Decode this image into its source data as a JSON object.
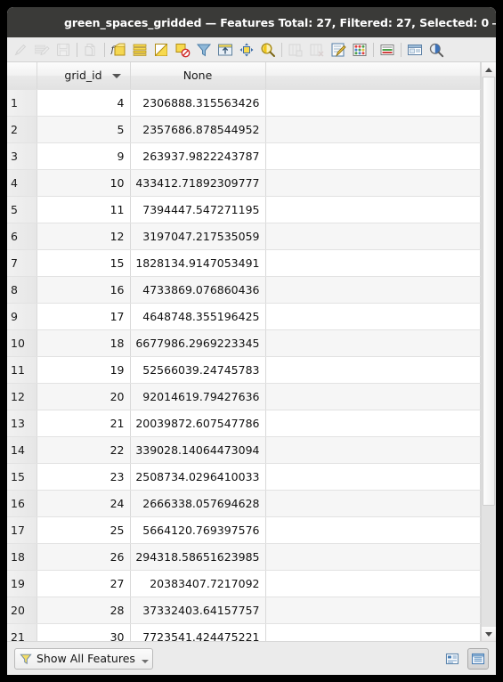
{
  "window": {
    "title": "green_spaces_gridded — Features Total: 27, Filtered: 27, Selected: 0",
    "buttons": {
      "minimize": "—",
      "maximize": "+",
      "close": "×"
    }
  },
  "toolbar": {
    "items": [
      {
        "name": "toggle-editing-icon",
        "label": "Toggle editing mode",
        "disabled": true
      },
      {
        "name": "multi-edit-icon",
        "label": "Toggle multi edit mode",
        "disabled": true
      },
      {
        "name": "save-edits-icon",
        "label": "Save edits",
        "disabled": true
      },
      {
        "name": "separator",
        "label": "",
        "disabled": false
      },
      {
        "name": "reload-table-icon",
        "label": "Reload the table",
        "disabled": true
      },
      {
        "name": "separator",
        "label": "",
        "disabled": false
      },
      {
        "name": "select-by-expression-icon",
        "label": "Select features using an expression",
        "disabled": false
      },
      {
        "name": "select-all-icon",
        "label": "Select all features",
        "disabled": false
      },
      {
        "name": "invert-selection-icon",
        "label": "Invert selection",
        "disabled": false
      },
      {
        "name": "deselect-all-icon",
        "label": "Deselect all features",
        "disabled": false
      },
      {
        "name": "filter-selection-icon",
        "label": "Filter / select features",
        "disabled": false
      },
      {
        "name": "move-selection-to-top-icon",
        "label": "Move selection to top",
        "disabled": false
      },
      {
        "name": "pan-to-selection-icon",
        "label": "Pan map to selected rows",
        "disabled": false
      },
      {
        "name": "zoom-to-selection-icon",
        "label": "Zoom map to selected rows",
        "disabled": false
      },
      {
        "name": "separator",
        "label": "",
        "disabled": false
      },
      {
        "name": "new-field-icon",
        "label": "New field",
        "disabled": true
      },
      {
        "name": "delete-field-icon",
        "label": "Delete field",
        "disabled": true
      },
      {
        "name": "open-field-calculator-icon",
        "label": "Open field calculator",
        "disabled": false
      },
      {
        "name": "conditional-formatting-icon",
        "label": "Conditional formatting",
        "disabled": false
      },
      {
        "name": "separator",
        "label": "",
        "disabled": false
      },
      {
        "name": "organize-columns-icon",
        "label": "Organize columns",
        "disabled": false
      },
      {
        "name": "separator",
        "label": "",
        "disabled": false
      },
      {
        "name": "actions-icon",
        "label": "Actions",
        "disabled": false
      },
      {
        "name": "form-view-search-icon",
        "label": "Expression select",
        "disabled": false
      }
    ]
  },
  "table": {
    "columns": [
      {
        "key": "rownum",
        "label": "",
        "sortable": false
      },
      {
        "key": "grid_id",
        "label": "grid_id",
        "sortable": true
      },
      {
        "key": "none",
        "label": "None",
        "sortable": false
      },
      {
        "key": "blank",
        "label": "",
        "sortable": false
      }
    ],
    "rows": [
      {
        "rownum": "1",
        "grid_id": "4",
        "none": "2306888.315563426"
      },
      {
        "rownum": "2",
        "grid_id": "5",
        "none": "2357686.878544952"
      },
      {
        "rownum": "3",
        "grid_id": "9",
        "none": "263937.9822243787"
      },
      {
        "rownum": "4",
        "grid_id": "10",
        "none": "433412.71892309777"
      },
      {
        "rownum": "5",
        "grid_id": "11",
        "none": "7394447.547271195"
      },
      {
        "rownum": "6",
        "grid_id": "12",
        "none": "3197047.217535059"
      },
      {
        "rownum": "7",
        "grid_id": "15",
        "none": "1828134.9147053491"
      },
      {
        "rownum": "8",
        "grid_id": "16",
        "none": "4733869.076860436"
      },
      {
        "rownum": "9",
        "grid_id": "17",
        "none": "4648748.355196425"
      },
      {
        "rownum": "10",
        "grid_id": "18",
        "none": "6677986.2969223345"
      },
      {
        "rownum": "11",
        "grid_id": "19",
        "none": "52566039.24745783"
      },
      {
        "rownum": "12",
        "grid_id": "20",
        "none": "92014619.79427636"
      },
      {
        "rownum": "13",
        "grid_id": "21",
        "none": "20039872.607547786"
      },
      {
        "rownum": "14",
        "grid_id": "22",
        "none": "339028.14064473094"
      },
      {
        "rownum": "15",
        "grid_id": "23",
        "none": "2508734.0296410033"
      },
      {
        "rownum": "16",
        "grid_id": "24",
        "none": "2666338.057694628"
      },
      {
        "rownum": "17",
        "grid_id": "25",
        "none": "5664120.769397576"
      },
      {
        "rownum": "18",
        "grid_id": "26",
        "none": "294318.58651623985"
      },
      {
        "rownum": "19",
        "grid_id": "27",
        "none": "20383407.7217092"
      },
      {
        "rownum": "20",
        "grid_id": "28",
        "none": "37332403.64157757"
      },
      {
        "rownum": "21",
        "grid_id": "30",
        "none": "7723541.424475221"
      }
    ]
  },
  "scrollbar": {
    "up_arrow": "▲",
    "down_arrow": "▼",
    "thumb_percent": "78"
  },
  "statusbar": {
    "filter_label": "Show All Features",
    "filter_icon": "funnel-icon",
    "view_form_label": "Switch to form view",
    "view_table_label": "Switch to table view"
  },
  "colors": {
    "accent": "#f0922b",
    "titlebar": "#3a3a38",
    "chrome": "#ebebeb",
    "row_alt": "#f6f6f6"
  }
}
